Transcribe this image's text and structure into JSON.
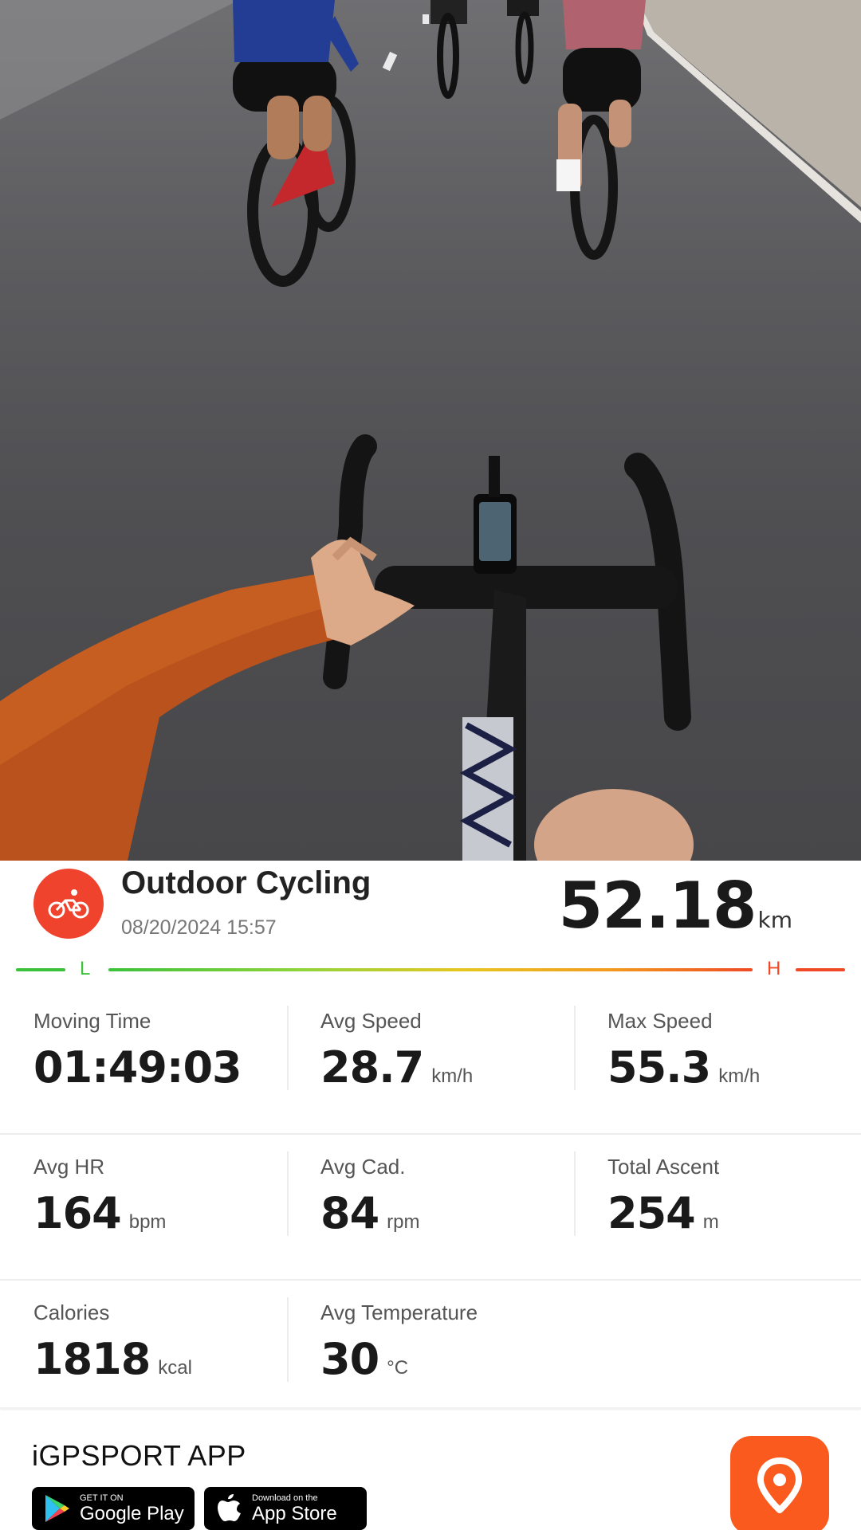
{
  "activity": {
    "title": "Outdoor Cycling",
    "datetime": "08/20/2024 15:57",
    "distance_value": "52.18",
    "distance_unit": "km",
    "icon": "cycling-icon"
  },
  "intensity": {
    "low_label": "L",
    "high_label": "H"
  },
  "stats": [
    {
      "label": "Moving Time",
      "value": "01:49:03",
      "unit": ""
    },
    {
      "label": "Avg Speed",
      "value": "28.7",
      "unit": "km/h"
    },
    {
      "label": "Max Speed",
      "value": "55.3",
      "unit": "km/h"
    },
    {
      "label": "Avg HR",
      "value": "164",
      "unit": "bpm"
    },
    {
      "label": "Avg Cad.",
      "value": "84",
      "unit": "rpm"
    },
    {
      "label": "Total Ascent",
      "value": "254",
      "unit": "m"
    },
    {
      "label": "Calories",
      "value": "1818",
      "unit": "kcal"
    },
    {
      "label": "Avg Temperature",
      "value": "30",
      "unit": "°C"
    }
  ],
  "footer": {
    "app_name": "iGPSPORT APP",
    "google_play": {
      "small": "GET IT ON",
      "big": "Google Play"
    },
    "app_store": {
      "small": "Download on the",
      "big": "App Store"
    },
    "logo_icon": "location-pin-icon"
  },
  "colors": {
    "accent_red": "#f0432d",
    "logo_orange": "#fa5a1e",
    "intensity_low": "#3cc13b",
    "intensity_high": "#ef4a25"
  }
}
